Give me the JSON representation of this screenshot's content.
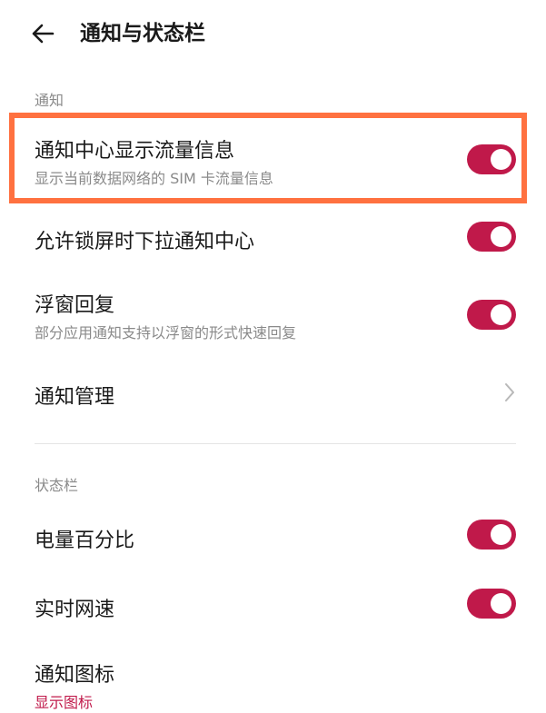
{
  "header": {
    "title": "通知与状态栏",
    "back_icon": "arrow-left-icon"
  },
  "sections": {
    "notification_label": "通知",
    "statusbar_label": "状态栏"
  },
  "rows": {
    "traffic_info": {
      "title": "通知中心显示流量信息",
      "subtitle": "显示当前数据网络的 SIM 卡流量信息",
      "enabled": true
    },
    "lockscreen_pull": {
      "title": "允许锁屏时下拉通知中心",
      "enabled": true
    },
    "float_reply": {
      "title": "浮窗回复",
      "subtitle": "部分应用通知支持以浮窗的形式快速回复",
      "enabled": true
    },
    "notify_manage": {
      "title": "通知管理",
      "icon": "chevron-right-icon"
    },
    "battery_percent": {
      "title": "电量百分比",
      "enabled": true
    },
    "net_speed": {
      "title": "实时网速",
      "enabled": true
    },
    "notify_icons": {
      "title": "通知图标",
      "subtitle": "显示图标"
    }
  },
  "colors": {
    "accent": "#c0194a",
    "highlight": "#ff7140"
  }
}
